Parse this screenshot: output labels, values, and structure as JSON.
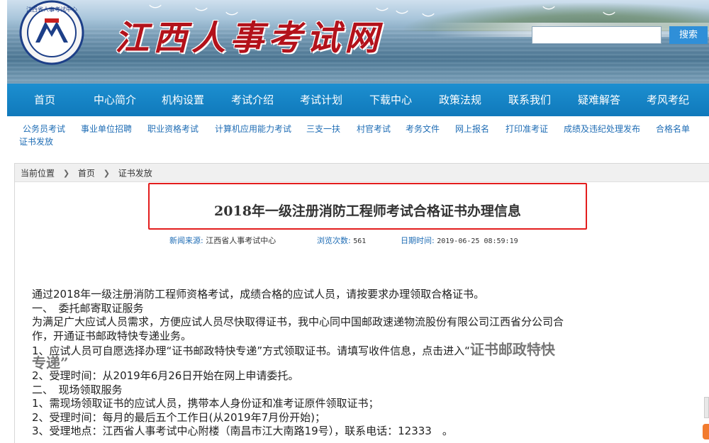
{
  "header": {
    "site_title": "江西人事考试网",
    "logo_text": "江西省人事考试中心",
    "search": {
      "placeholder": "",
      "button_label": "搜索"
    }
  },
  "nav": {
    "items": [
      {
        "label": "首页"
      },
      {
        "label": "中心简介"
      },
      {
        "label": "机构设置"
      },
      {
        "label": "考试介绍"
      },
      {
        "label": "考试计划"
      },
      {
        "label": "下载中心"
      },
      {
        "label": "政策法规"
      },
      {
        "label": "联系我们"
      },
      {
        "label": "疑难解答"
      },
      {
        "label": "考风考纪"
      }
    ]
  },
  "subnav": {
    "items": [
      {
        "label": "公务员考试"
      },
      {
        "label": "事业单位招聘"
      },
      {
        "label": "职业资格考试"
      },
      {
        "label": "计算机应用能力考试"
      },
      {
        "label": "三支一扶"
      },
      {
        "label": "村官考试"
      },
      {
        "label": "考务文件"
      },
      {
        "label": "网上报名"
      },
      {
        "label": "打印准考证"
      },
      {
        "label": "成绩及违纪处理发布"
      },
      {
        "label": "合格名单"
      },
      {
        "label": "证书发放"
      }
    ]
  },
  "breadcrumb": {
    "label": "当前位置",
    "items": [
      "首页",
      "证书发放"
    ]
  },
  "article": {
    "title": "2018年一级注册消防工程师考试合格证书办理信息",
    "source_label": "新闻来源:",
    "source_value": "江西省人事考试中心",
    "views_label": "浏览次数:",
    "views_value": "561",
    "date_label": "日期时间:",
    "date_value": "2019-06-25 08:59:19",
    "lines": [
      "通过2018年一级注册消防工程师资格考试，成绩合格的应试人员，请按要求办理领取合格证书。",
      "一、　委托邮寄取证服务",
      "为满足广大应试人员需求，方便应试人员尽快取得证书，我中心同中国邮政速递物流股份有限公司江西省分公司合",
      "作，开通证书邮政特快专递业务。",
      "1、应试人员可自愿选择办理“证书邮政特快专递”方式领取证书。请填写收件信息，点击进入“",
      "证书邮政特快",
      "专递”",
      "2、受理时间：从2019年6月26日开始在网上申请委托。",
      "二、　现场领取服务",
      "1、需现场领取证书的应试人员，携带本人身份证和准考证原件领取证书；",
      "2、受理时间：每月的最后五个工作日(从2019年7月份开始)；",
      "3、受理地点：江西省人事考试中心附楼（南昌市江大南路19号），联系电话：12333　。"
    ]
  },
  "colors": {
    "nav_bg": "#1483c6",
    "title_red": "#b3121b",
    "highlight_border": "#e31d1d",
    "link_blue": "#1f6db5"
  }
}
